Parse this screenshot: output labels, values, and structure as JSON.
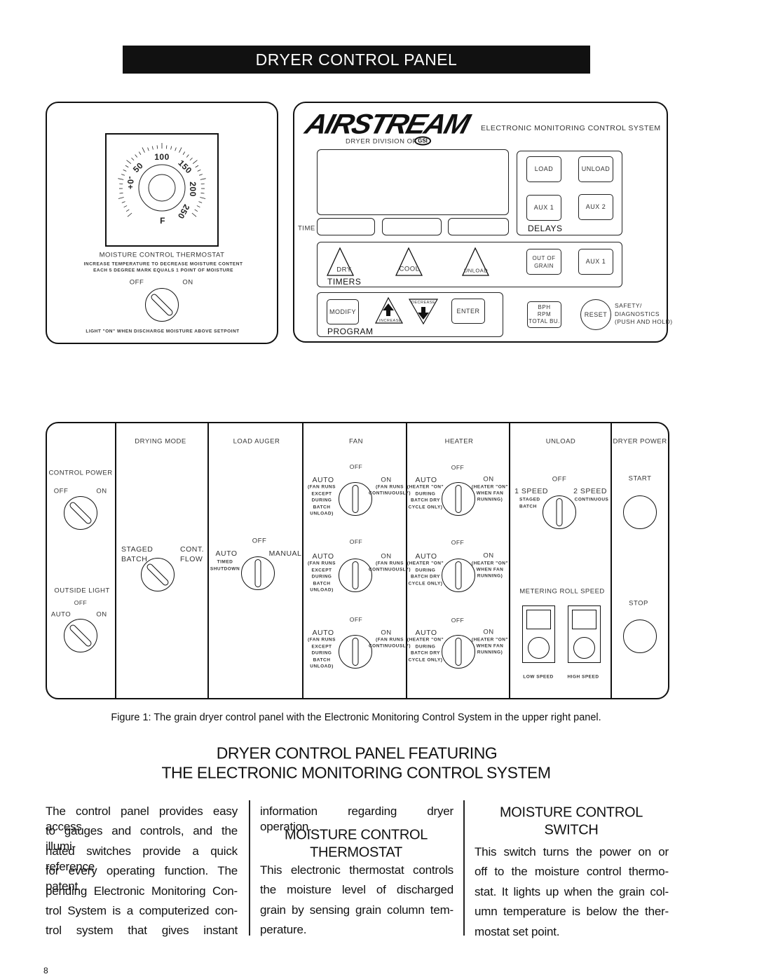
{
  "title": "DRYER CONTROL PANEL",
  "thermostat_panel": {
    "dial_labels": [
      "-0+",
      "50",
      "100",
      "150",
      "200",
      "250",
      "F"
    ],
    "label": "MOISTURE CONTROL THERMOSTAT",
    "instruction_1": "INCREASE TEMPERATURE TO DECREASE MOISTURE CONTENT",
    "instruction_2": "EACH 5 DEGREE MARK EQUALS 1 POINT OF MOISTURE",
    "off": "OFF",
    "on": "ON",
    "light_note": "LIGHT \"ON\" WHEN DISCHARGE MOISTURE ABOVE SETPOINT"
  },
  "emcs_panel": {
    "logo": "AIRSTREAM",
    "system_name": "ELECTRONIC MONITORING CONTROL SYSTEM",
    "division": "DRYER DIVISION OF",
    "division_logo": "GSI",
    "time_label": "TIME",
    "delays": {
      "label": "DELAYS",
      "load": "LOAD",
      "unload": "UNLOAD",
      "aux1": "AUX 1",
      "aux2": "AUX 2"
    },
    "timers": {
      "label": "TIMERS",
      "dry": "DRY",
      "cool": "COOL",
      "unload": "UNLOAD",
      "out_of_grain_1": "OUT OF",
      "out_of_grain_2": "GRAIN",
      "aux1": "AUX 1"
    },
    "program": {
      "label": "PROGRAM",
      "modify": "MODIFY",
      "increase": "INCREASE",
      "decrease": "DECREASE",
      "enter": "ENTER"
    },
    "readout": {
      "bph": "BPH",
      "rpm": "RPM",
      "total": "TOTAL BU."
    },
    "reset": "RESET",
    "safety": [
      "SAFETY/",
      "DIAGNOSTICS",
      "(PUSH AND HOLD)"
    ]
  },
  "switch_panel": {
    "control_power": {
      "label": "CONTROL POWER",
      "off": "OFF",
      "on": "ON"
    },
    "outside_light": {
      "label": "OUTSIDE LIGHT",
      "off": "OFF",
      "auto": "AUTO",
      "on": "ON"
    },
    "drying_mode": {
      "header": "DRYING MODE",
      "staged": "STAGED",
      "batch": "BATCH",
      "cont": "CONT.",
      "flow": "FLOW"
    },
    "load_auger": {
      "header": "LOAD AUGER",
      "off": "OFF",
      "auto": "AUTO",
      "timed": "TIMED",
      "shutdown": "SHUTDOWN",
      "manual": "MANUAL"
    },
    "fan": {
      "header": "FAN",
      "off": "OFF",
      "auto": "AUTO",
      "auto_note": [
        "(FAN RUNS",
        "EXCEPT",
        "DURING",
        "BATCH",
        "UNLOAD)"
      ],
      "on": "ON",
      "on_note": [
        "(FAN RUNS",
        "CONTINUOUSLY)"
      ]
    },
    "heater": {
      "header": "HEATER",
      "off": "OFF",
      "auto": "AUTO",
      "auto_note": [
        "(HEATER \"ON\"",
        "DURING",
        "BATCH DRY",
        "CYCLE ONLY)"
      ],
      "on": "ON",
      "on_note": [
        "(HEATER \"ON\"",
        "WHEN FAN",
        "RUNNING)"
      ]
    },
    "unload": {
      "header": "UNLOAD",
      "off": "OFF",
      "speed1": "1 SPEED",
      "staged": "STAGED",
      "batch": "BATCH",
      "speed2": "2 SPEED",
      "continuous": "CONTINUOUS",
      "metering": "METERING ROLL SPEED",
      "low": "LOW SPEED",
      "high": "HIGH SPEED"
    },
    "dryer_power": {
      "header": "DRYER POWER",
      "start": "START",
      "stop": "STOP"
    }
  },
  "caption": "Figure 1:  The grain dryer control panel with the Electronic Monitoring Control System in the upper right panel.",
  "heading_1": "DRYER CONTROL PANEL FEATURING",
  "heading_2": "THE ELECTRONIC MONITORING CONTROL SYSTEM",
  "col1_lines": [
    "The control panel provides easy access",
    "to gauges and controls, and the illumi-",
    "nated switches provide a quick reference",
    "for every operating function.  The patent",
    "pending Electronic Monitoring Con-",
    "trol System is a computerized con-",
    "trol  system  that  gives  instant"
  ],
  "col2_first": "information regarding dryer operation.",
  "col2_heading": [
    "MOISTURE CONTROL",
    "THERMOSTAT"
  ],
  "col2_lines": [
    "This electronic thermostat controls",
    "the moisture level of discharged",
    "grain by sensing grain column tem-",
    "perature."
  ],
  "col3_heading": [
    "MOISTURE CONTROL",
    "SWITCH"
  ],
  "col3_lines": [
    "This switch turns the power on or",
    "off to the moisture control thermo-",
    "stat.  It lights up when the grain col-",
    "umn temperature is below the ther-",
    "mostat set point."
  ],
  "page_number": "8"
}
